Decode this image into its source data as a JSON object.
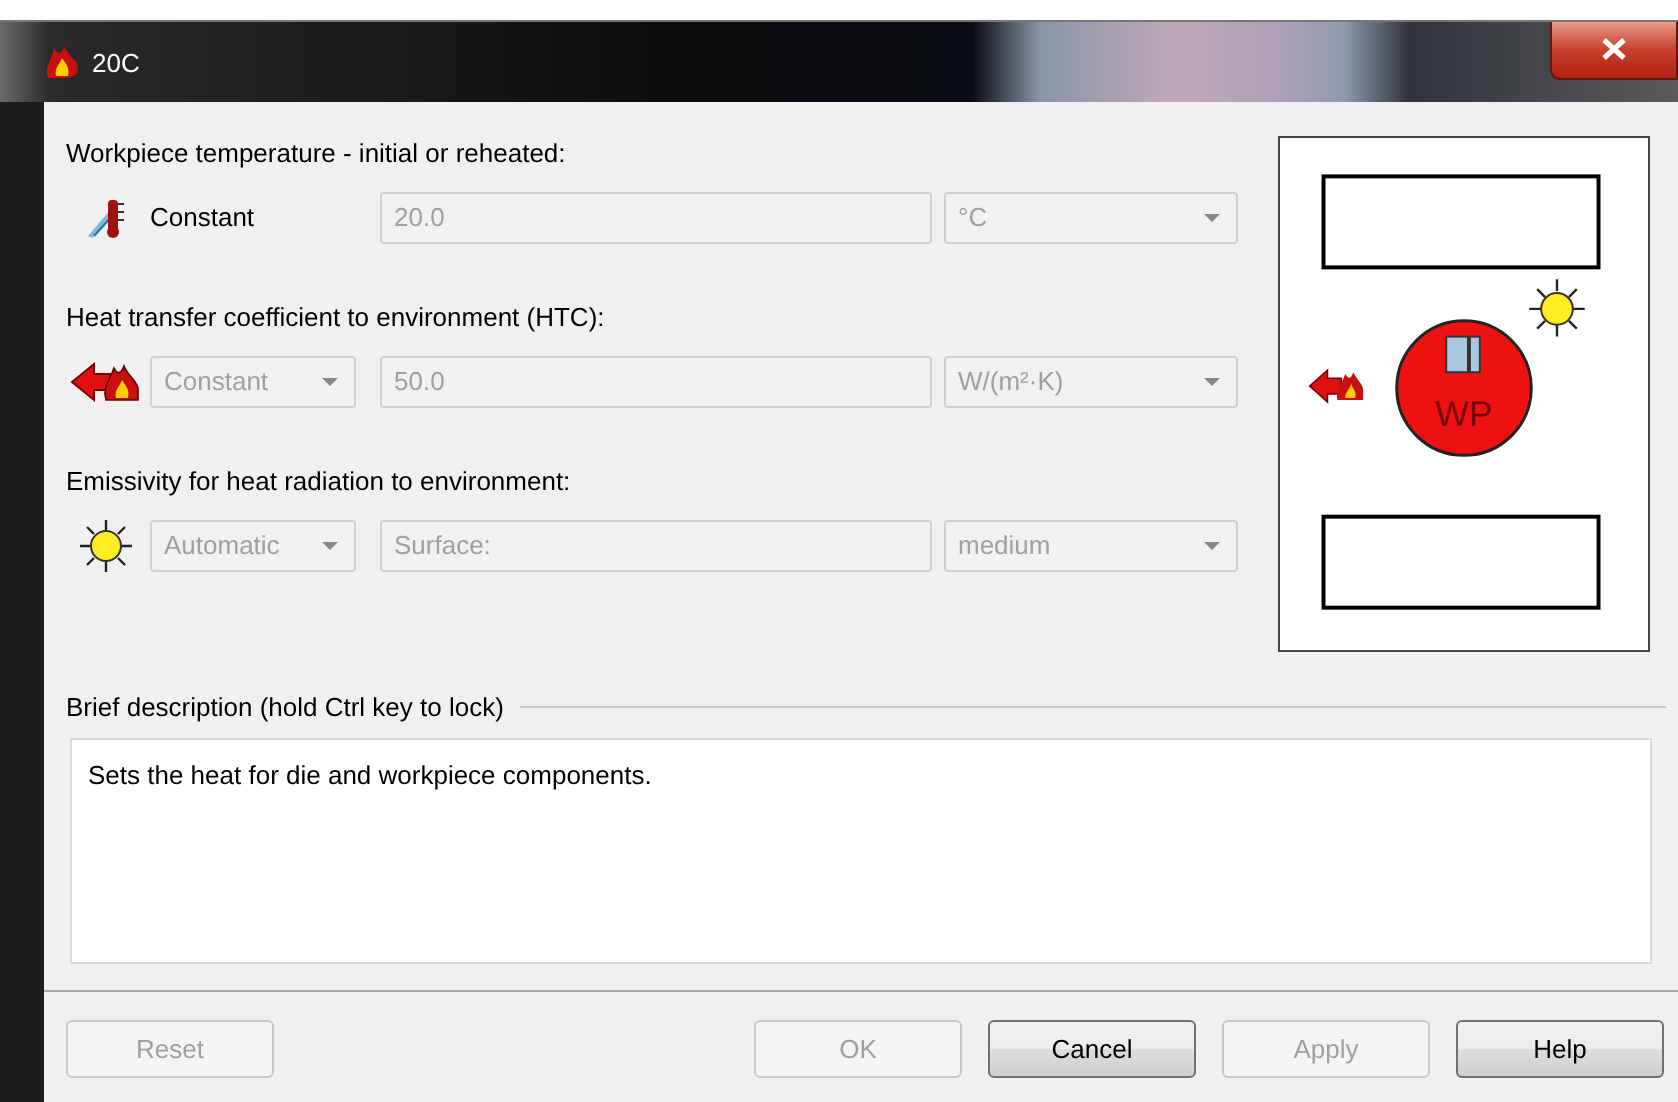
{
  "window": {
    "title": "20C"
  },
  "sections": [
    {
      "heading": "Workpiece temperature - initial or reheated:",
      "mode": {
        "kind": "label",
        "text": "Constant",
        "disabled": false
      },
      "value": {
        "text": "20.0",
        "disabled": true
      },
      "unit": {
        "text": "°C",
        "disabled": true
      }
    },
    {
      "heading": "Heat transfer coefficient to environment (HTC):",
      "mode": {
        "kind": "combo",
        "text": "Constant",
        "disabled": true
      },
      "value": {
        "text": "50.0",
        "disabled": true
      },
      "unit": {
        "text": "W/(m²·K)",
        "disabled": true
      }
    },
    {
      "heading": "Emissivity for heat radiation to environment:",
      "mode": {
        "kind": "combo",
        "text": "Automatic",
        "disabled": true
      },
      "value": {
        "text": "Surface:",
        "disabled": true
      },
      "unit": {
        "text": "medium",
        "disabled": true
      }
    }
  ],
  "diagram": {
    "label": "WP"
  },
  "description": {
    "heading": "Brief description (hold Ctrl key to lock)",
    "text": "Sets the heat for die and workpiece components."
  },
  "buttons": [
    {
      "label": "Reset",
      "disabled": true
    },
    {
      "label": "OK",
      "disabled": true
    },
    {
      "label": "Cancel",
      "disabled": false
    },
    {
      "label": "Apply",
      "disabled": true
    },
    {
      "label": "Help",
      "disabled": false
    }
  ]
}
